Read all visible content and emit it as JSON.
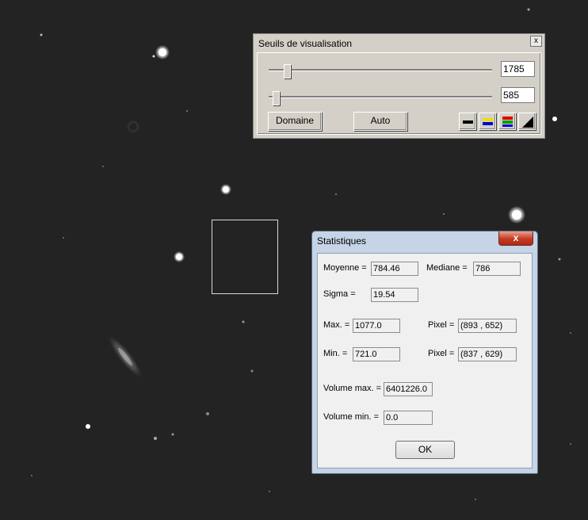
{
  "thresholds_window": {
    "title": "Seuils de visualisation",
    "close_label": "x",
    "high_value": "1785",
    "low_value": "585",
    "high_slider_fraction": 0.07,
    "low_slider_fraction": 0.02,
    "domain_button": "Domaine",
    "auto_button": "Auto",
    "palette_icons": [
      "black-bar-icon",
      "yellow-blue-palette-icon",
      "rgb-palette-icon",
      "gradient-triangle-icon"
    ]
  },
  "stats_window": {
    "title": "Statistiques",
    "close_label": "x",
    "mean_label": "Moyenne =",
    "mean_value": "784.46",
    "median_label": "Mediane =",
    "median_value": "786",
    "sigma_label": "Sigma =",
    "sigma_value": "19.54",
    "max_label": "Max. =",
    "max_value": "1077.0",
    "max_pixel_label": "Pixel =",
    "max_pixel_value": "(893 , 652)",
    "min_label": "Min. =",
    "min_value": "721.0",
    "min_pixel_label": "Pixel =",
    "min_pixel_value": "(837 , 629)",
    "volume_max_label": "Volume max. =",
    "volume_max_value": "6401226.0",
    "volume_min_label": "Volume min. =",
    "volume_min_value": "0.0",
    "ok_button": "OK"
  },
  "colors": {
    "sky_background": "#232323",
    "dialog_face": "#d4d0c8",
    "aero_frame": "#c5d4e6",
    "close_red": "#c53a22"
  }
}
